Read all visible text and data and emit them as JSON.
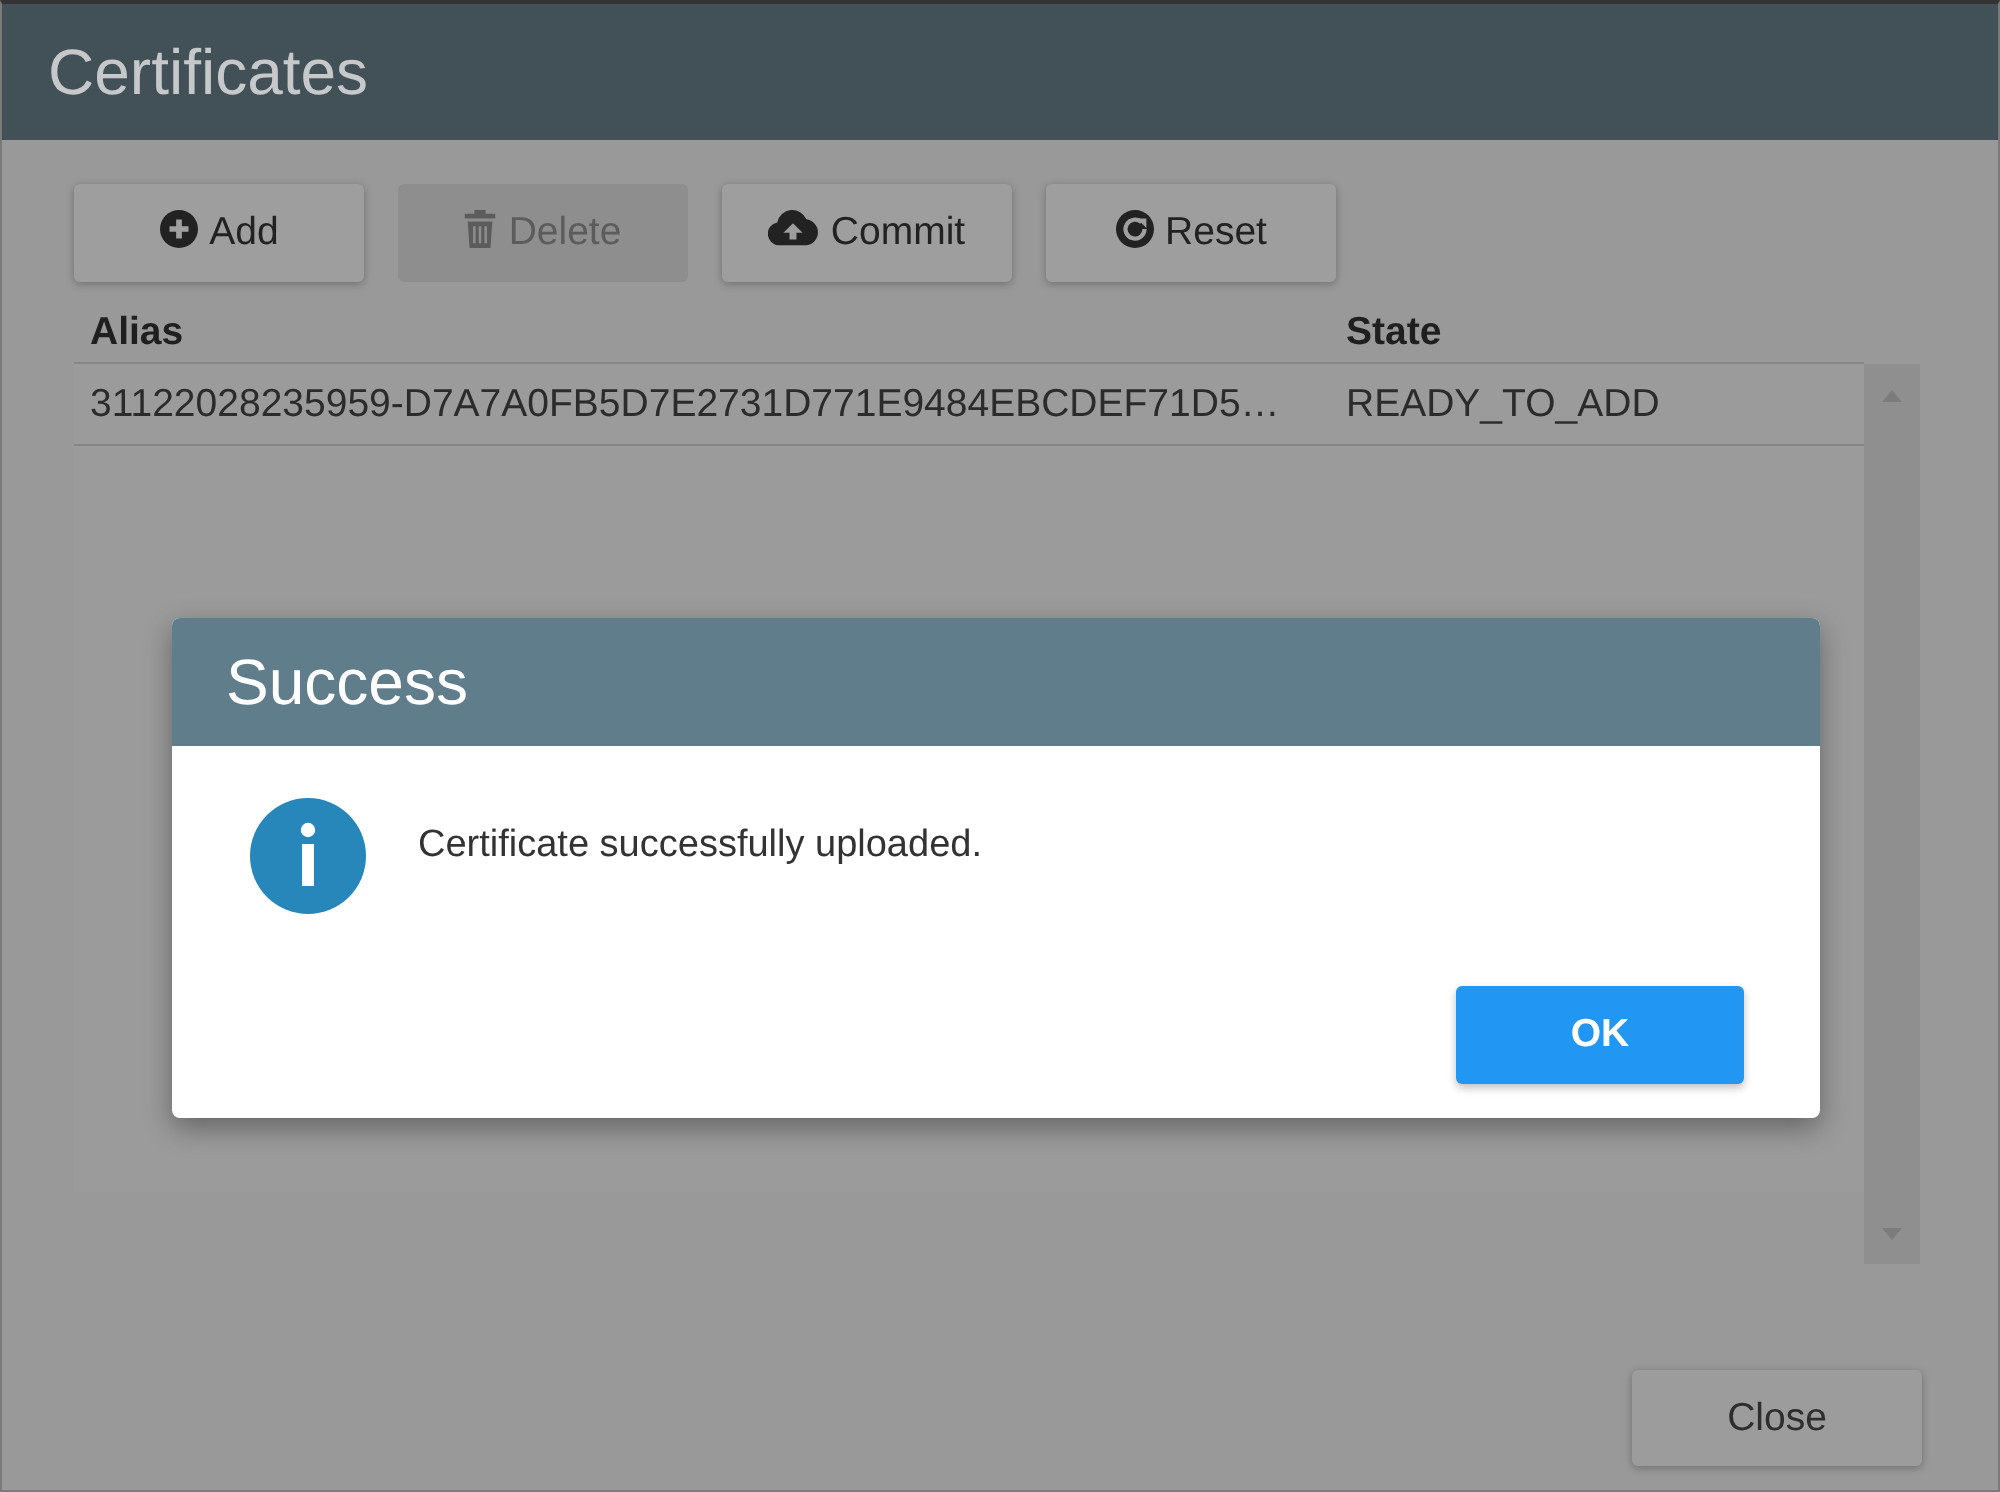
{
  "window": {
    "title": "Certificates"
  },
  "toolbar": [
    {
      "label": "Add",
      "kind": "add",
      "disabled": false
    },
    {
      "label": "Delete",
      "kind": "delete",
      "disabled": true
    },
    {
      "label": "Commit",
      "kind": "commit",
      "disabled": false
    },
    {
      "label": "Reset",
      "kind": "reset",
      "disabled": false
    }
  ],
  "table": {
    "columns": [
      "Alias",
      "State"
    ],
    "rows": [
      {
        "alias": "31122028235959-D7A7A0FB5D7E2731D771E9484EBCDEF71D5…",
        "state": "READY_TO_ADD"
      }
    ]
  },
  "footer": {
    "close_button": "Close"
  },
  "dialog": {
    "title": "Success",
    "kind": "info",
    "message": "Certificate successfully uploaded.",
    "button": "OK"
  }
}
